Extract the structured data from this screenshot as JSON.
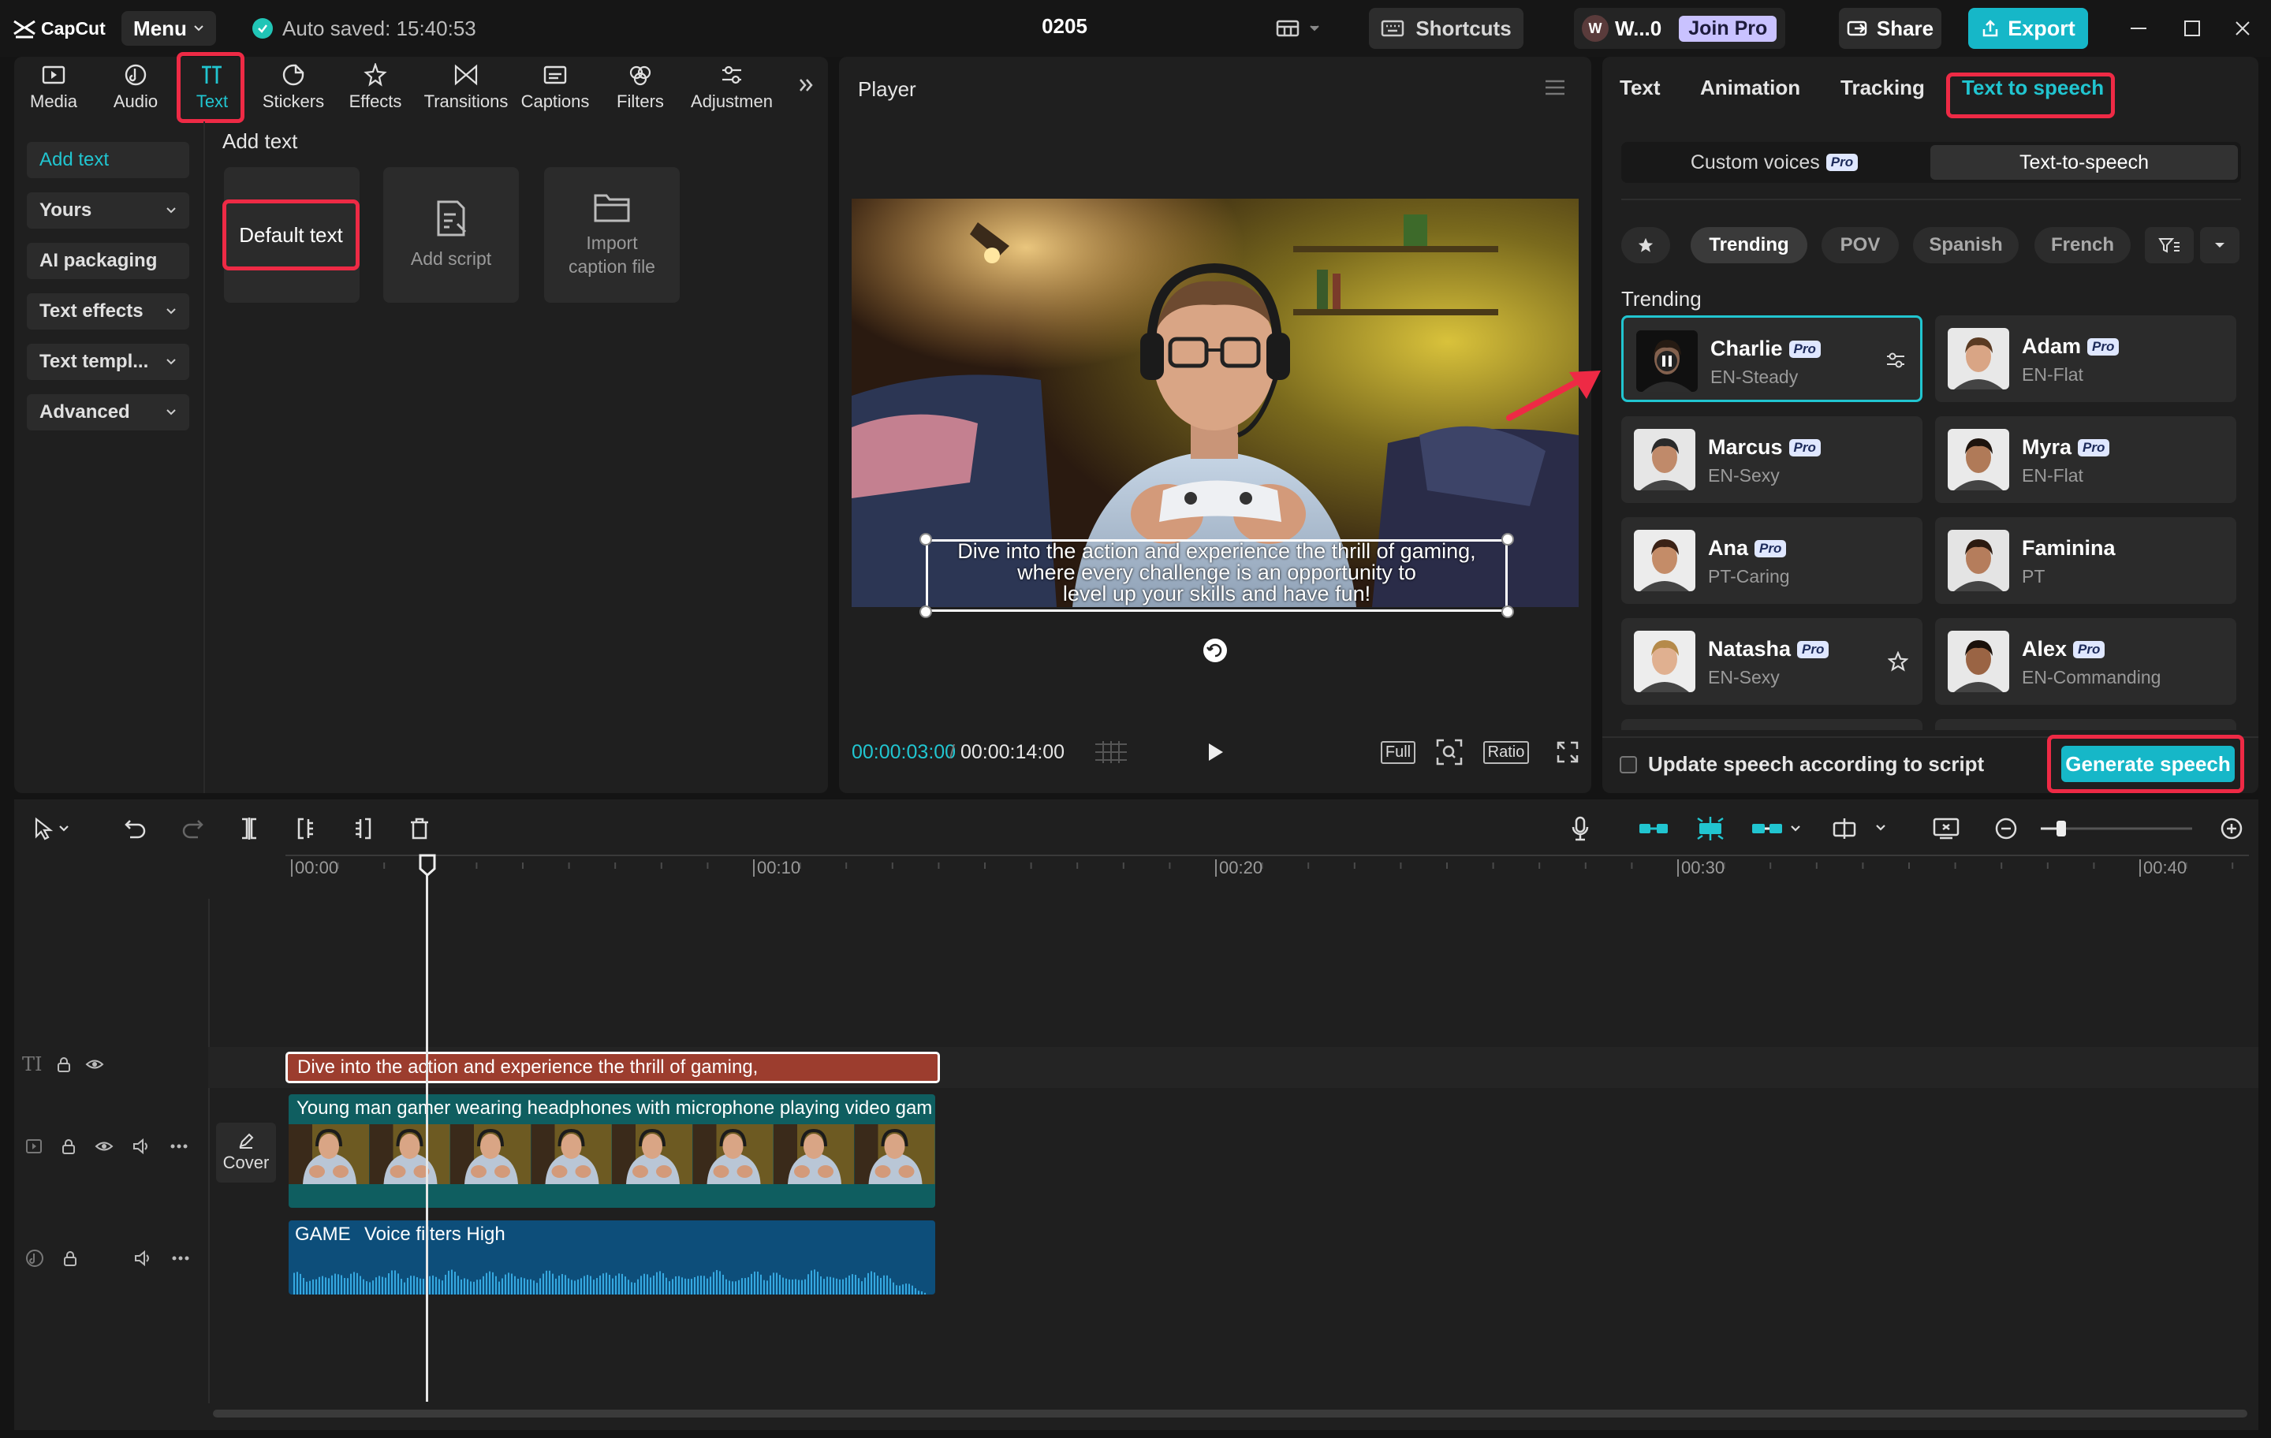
{
  "titlebar": {
    "app_name": "CapCut",
    "menu_label": "Menu",
    "autosave": "Auto saved: 15:40:53",
    "project_name": "0205",
    "shortcuts_label": "Shortcuts",
    "account_initial": "W",
    "account_name": "W...0",
    "join_pro_label": "Join Pro",
    "share_label": "Share",
    "export_label": "Export"
  },
  "toolbar": {
    "tabs": [
      {
        "label": "Media",
        "icon": "media-icon"
      },
      {
        "label": "Audio",
        "icon": "audio-icon"
      },
      {
        "label": "Text",
        "icon": "text-icon",
        "active": true
      },
      {
        "label": "Stickers",
        "icon": "sticker-icon"
      },
      {
        "label": "Effects",
        "icon": "effects-icon"
      },
      {
        "label": "Transitions",
        "icon": "transitions-icon"
      },
      {
        "label": "Captions",
        "icon": "captions-icon"
      },
      {
        "label": "Filters",
        "icon": "filters-icon"
      },
      {
        "label": "Adjustmen",
        "icon": "adjustment-icon"
      }
    ]
  },
  "text_sidebar": {
    "items": [
      {
        "label": "Add text",
        "active": true,
        "dropdown": false
      },
      {
        "label": "Yours",
        "dropdown": true
      },
      {
        "label": "AI packaging",
        "dropdown": false
      },
      {
        "label": "Text effects",
        "dropdown": true
      },
      {
        "label": "Text templ...",
        "dropdown": true
      },
      {
        "label": "Advanced",
        "dropdown": true
      }
    ]
  },
  "add_text": {
    "heading": "Add text",
    "default_text": "Default text",
    "add_script": "Add script",
    "import_caption": "Import caption file"
  },
  "player": {
    "title": "Player",
    "caption_lines": [
      "Dive into the action and experience the thrill of gaming,",
      "where every challenge is an opportunity to",
      "level up your skills and have fun!"
    ],
    "time_current": "00:00:03:00",
    "time_total": "00:00:14:00",
    "full_label": "Full",
    "ratio_label": "Ratio"
  },
  "right_panel": {
    "tabs": [
      "Text",
      "Animation",
      "Tracking",
      "Text to speech"
    ],
    "active_tab": "Text to speech",
    "segments": [
      {
        "label": "Custom voices",
        "pro": true
      },
      {
        "label": "Text-to-speech",
        "pro": false,
        "active": true
      }
    ],
    "pro_label": "Pro",
    "filters": [
      "Trending",
      "POV",
      "Spanish",
      "French"
    ],
    "section_heading": "Trending",
    "voices": [
      {
        "name": "Charlie",
        "desc": "EN-Steady",
        "pro": true,
        "selected": true
      },
      {
        "name": "Adam",
        "desc": "EN-Flat",
        "pro": true
      },
      {
        "name": "Marcus",
        "desc": "EN-Sexy",
        "pro": true
      },
      {
        "name": "Myra",
        "desc": "EN-Flat",
        "pro": true
      },
      {
        "name": "Ana",
        "desc": "PT-Caring",
        "pro": true
      },
      {
        "name": "Faminina",
        "desc": "PT",
        "pro": false
      },
      {
        "name": "Natasha",
        "desc": "EN-Sexy",
        "pro": true
      },
      {
        "name": "Alex",
        "desc": "EN-Commanding",
        "pro": true
      }
    ],
    "update_label": "Update speech according to script",
    "generate_label": "Generate speech"
  },
  "timeline": {
    "ruler_labels": [
      "00:00",
      "00:10",
      "00:20",
      "00:30",
      "00:40"
    ],
    "text_clip": "Dive into the action and experience the thrill of gaming,",
    "video_clip": "Young man gamer wearing headphones with microphone playing video gam",
    "cover_label": "Cover",
    "audio_name": "GAME",
    "audio_filter": "Voice filters High"
  },
  "colors": {
    "accent": "#21c5d0",
    "highlight": "#ee2a45",
    "text_clip": "#9c3d2e",
    "video_clip": "#0f5e60",
    "audio_clip": "#0d4e7a"
  }
}
